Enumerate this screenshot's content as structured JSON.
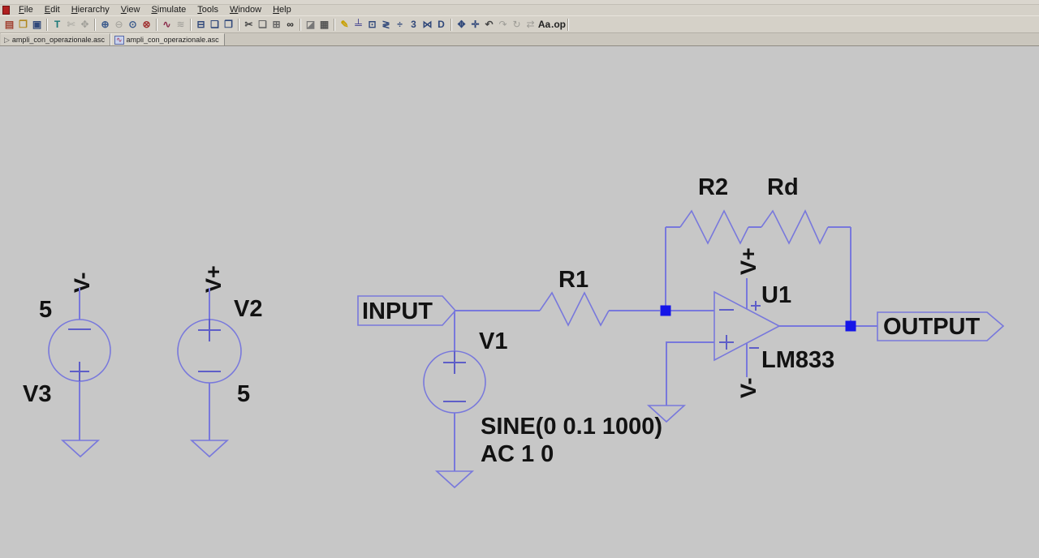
{
  "window": {
    "note": "top edge of title bar (cut off)"
  },
  "menu": {
    "items": [
      {
        "label": "File"
      },
      {
        "label": "Edit"
      },
      {
        "label": "Hierarchy"
      },
      {
        "label": "View"
      },
      {
        "label": "Simulate"
      },
      {
        "label": "Tools"
      },
      {
        "label": "Window"
      },
      {
        "label": "Help"
      }
    ]
  },
  "toolbar": {
    "items": [
      {
        "name": "new-schematic",
        "glyph": "▤",
        "color": "#a04030",
        "enabled": true
      },
      {
        "name": "open",
        "glyph": "❐",
        "color": "#b08820",
        "enabled": true
      },
      {
        "name": "save",
        "glyph": "▣",
        "color": "#30487a",
        "enabled": true
      },
      {
        "sep": true
      },
      {
        "name": "halt-hammer",
        "glyph": "T",
        "color": "#1a7878",
        "enabled": true
      },
      {
        "name": "run",
        "glyph": "✄",
        "color": "#9d9c96",
        "enabled": false
      },
      {
        "name": "pan-hand",
        "glyph": "✥",
        "color": "#9d9c96",
        "enabled": false
      },
      {
        "sep": true
      },
      {
        "name": "zoom-in",
        "glyph": "⊕",
        "color": "#3a5a8c",
        "enabled": true
      },
      {
        "name": "zoom-out",
        "glyph": "⊖",
        "color": "#9d9c96",
        "enabled": false
      },
      {
        "name": "zoom-extents",
        "glyph": "⊙",
        "color": "#3a5a8c",
        "enabled": true
      },
      {
        "name": "zoom-redraw",
        "glyph": "⊗",
        "color": "#a03030",
        "enabled": true
      },
      {
        "sep": true
      },
      {
        "name": "waveform-viewer",
        "glyph": "∿",
        "color": "#8a2a4a",
        "enabled": true
      },
      {
        "name": "schematic-view",
        "glyph": "≋",
        "color": "#9d9c96",
        "enabled": false
      },
      {
        "sep": true
      },
      {
        "name": "tile-windows",
        "glyph": "⊟",
        "color": "#30487a",
        "enabled": true
      },
      {
        "name": "cascade-windows",
        "glyph": "❏",
        "color": "#30487a",
        "enabled": true
      },
      {
        "name": "cascade-windows-2",
        "glyph": "❐",
        "color": "#30487a",
        "enabled": true
      },
      {
        "sep": true
      },
      {
        "name": "cut",
        "glyph": "✂",
        "color": "#444444",
        "enabled": true
      },
      {
        "name": "copy",
        "glyph": "❏",
        "color": "#666666",
        "enabled": true
      },
      {
        "name": "paste",
        "glyph": "⊞",
        "color": "#666666",
        "enabled": true
      },
      {
        "name": "find",
        "glyph": "∞",
        "color": "#222222",
        "enabled": true
      },
      {
        "sep": true
      },
      {
        "name": "copy-bitmap",
        "glyph": "◪",
        "color": "#777777",
        "enabled": true
      },
      {
        "name": "print",
        "glyph": "▦",
        "color": "#555555",
        "enabled": true
      },
      {
        "sep": true
      },
      {
        "name": "wire-pencil",
        "glyph": "✎",
        "color": "#c8a000",
        "enabled": true
      },
      {
        "name": "ground",
        "glyph": "╧",
        "color": "#3a3a8c",
        "enabled": true
      },
      {
        "name": "net-label",
        "glyph": "⊡",
        "color": "#30487a",
        "enabled": true
      },
      {
        "name": "resistor",
        "glyph": "≷",
        "color": "#30487a",
        "enabled": true
      },
      {
        "name": "capacitor",
        "glyph": "÷",
        "color": "#30487a",
        "enabled": true
      },
      {
        "name": "inductor",
        "glyph": "3",
        "color": "#30487a",
        "enabled": true
      },
      {
        "name": "diode",
        "glyph": "⋈",
        "color": "#30487a",
        "enabled": true
      },
      {
        "name": "component",
        "glyph": "D",
        "color": "#30487a",
        "enabled": true
      },
      {
        "sep": true
      },
      {
        "name": "move",
        "glyph": "✥",
        "color": "#30487a",
        "enabled": true
      },
      {
        "name": "drag",
        "glyph": "✛",
        "color": "#30487a",
        "enabled": true
      },
      {
        "name": "undo",
        "glyph": "↶",
        "color": "#444444",
        "enabled": true
      },
      {
        "name": "redo",
        "glyph": "↷",
        "color": "#9d9c96",
        "enabled": false
      },
      {
        "name": "rotate",
        "glyph": "↻",
        "color": "#9d9c96",
        "enabled": false
      },
      {
        "name": "mirror",
        "glyph": "⇄",
        "color": "#9d9c96",
        "enabled": false
      },
      {
        "name": "text",
        "glyph": "Aa",
        "color": "#222222",
        "enabled": true
      },
      {
        "name": "spice-directive",
        "glyph": ".op",
        "color": "#222222",
        "enabled": true
      },
      {
        "sep": true
      }
    ]
  },
  "tabs": [
    {
      "label": "ampli_con_operazionale.asc",
      "icon": "schematic-doc-icon",
      "icon_glyph": "▷",
      "active": false
    },
    {
      "label": "ampli_con_operazionale.asc",
      "icon": "waveform-doc-icon",
      "icon_glyph": "∿",
      "active": true
    }
  ],
  "schematic": {
    "colors": {
      "background": "#c7c7c7",
      "wire": "#7878dc",
      "junction": "#1515e8",
      "text": "#121212"
    },
    "v3": {
      "name": "V3",
      "value": "5",
      "net_label": "V-"
    },
    "v2": {
      "name": "V2",
      "value": "5",
      "net_label": "V+"
    },
    "v1": {
      "name": "V1",
      "param_sine": "SINE(0 0.1 1000)",
      "param_ac": "AC 1 0"
    },
    "r1": {
      "name": "R1"
    },
    "r2": {
      "name": "R2"
    },
    "rd": {
      "name": "Rd"
    },
    "u1": {
      "name": "U1",
      "model": "LM833",
      "vplus_pin": "V+",
      "vminus_pin": "V-"
    },
    "ports": {
      "input": "INPUT",
      "output": "OUTPUT"
    }
  }
}
